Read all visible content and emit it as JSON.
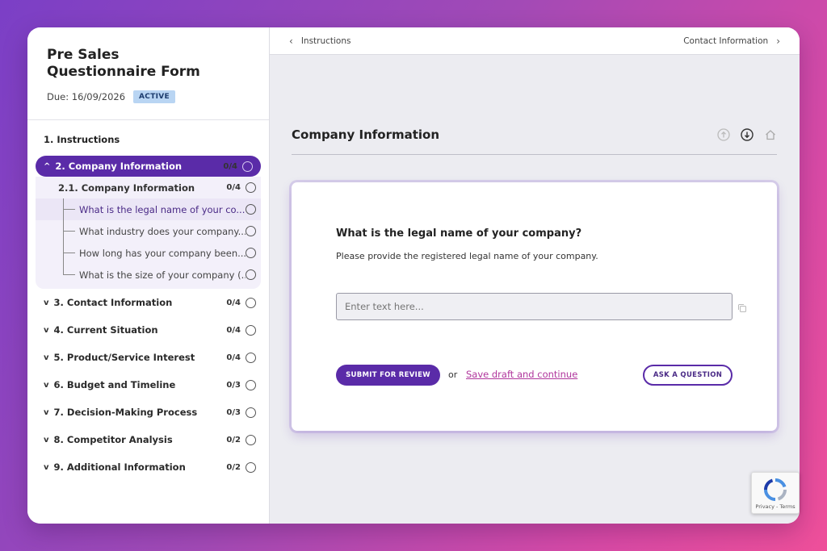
{
  "sidebar": {
    "form_title": "Pre Sales Questionnaire Form",
    "due": "Due: 16/09/2026",
    "status": "ACTIVE",
    "instructions": "1. Instructions",
    "active_section": {
      "label": "2. Company Information",
      "count": "0/4"
    },
    "subsection": {
      "label": "2.1. Company Information",
      "count": "0/4"
    },
    "questions": [
      "What is the legal name of your co...",
      "What industry does your company...",
      "How long has your company been...",
      "What is the size of your company (..."
    ],
    "sections": [
      {
        "label": "3. Contact Information",
        "count": "0/4"
      },
      {
        "label": "4. Current Situation",
        "count": "0/4"
      },
      {
        "label": "5. Product/Service Interest",
        "count": "0/4"
      },
      {
        "label": "6. Budget and Timeline",
        "count": "0/3"
      },
      {
        "label": "7. Decision-Making Process",
        "count": "0/3"
      },
      {
        "label": "8. Competitor Analysis",
        "count": "0/2"
      },
      {
        "label": "9. Additional Information",
        "count": "0/2"
      }
    ]
  },
  "topbar": {
    "prev": "Instructions",
    "next": "Contact Information"
  },
  "main": {
    "page_title": "Company Information",
    "question_title": "What is the legal name of your company?",
    "question_desc": "Please provide the registered legal name of your company.",
    "answer_placeholder": "Enter text here...",
    "submit_label": "SUBMIT FOR REVIEW",
    "or_text": "or",
    "save_link": "Save draft and continue",
    "ask_label": "ASK A QUESTION"
  },
  "recaptcha": {
    "text": "Privacy - Terms"
  },
  "colors": {
    "accent": "#5a2ba8",
    "link": "#b0359c",
    "badge": "#b9d5f3"
  }
}
